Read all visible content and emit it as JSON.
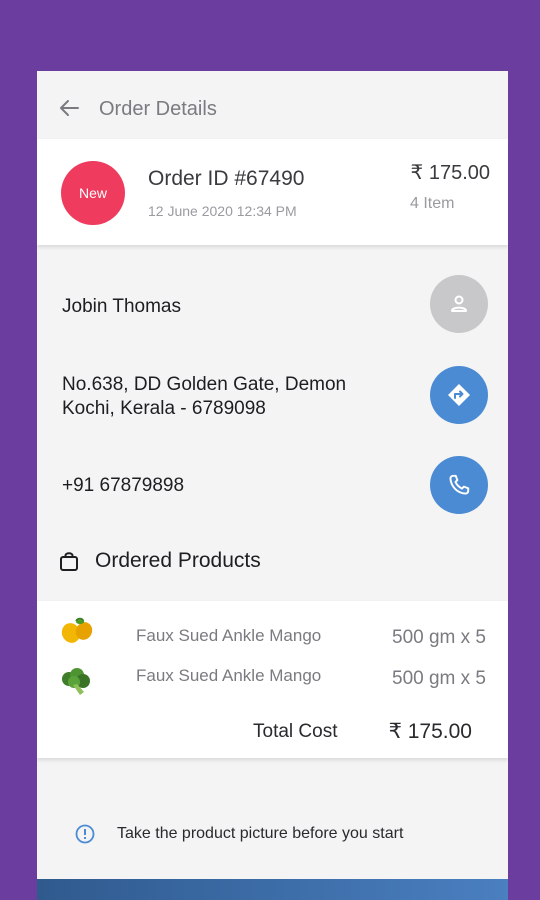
{
  "header": {
    "title": "Order Details"
  },
  "order": {
    "badge": "New",
    "id": "Order ID #67490",
    "date": "12 June 2020 12:34 PM",
    "price": "₹ 175.00",
    "items": "4 Item"
  },
  "customer": {
    "name": "Jobin Thomas",
    "address_line1": "No.638, DD Golden Gate, Demon",
    "address_line2": "Kochi, Kerala -  6789098",
    "phone": "+91 67879898"
  },
  "products_section": {
    "title": "Ordered Products"
  },
  "products": [
    {
      "name": "Faux Sued Ankle Mango",
      "qty": "500 gm x 5",
      "icon": "mango-icon"
    },
    {
      "name": "Faux Sued Ankle Mango",
      "qty": "500 gm x 5",
      "icon": "broccoli-icon"
    }
  ],
  "total": {
    "label": "Total Cost",
    "value": "₹ 175.00"
  },
  "notice": {
    "text": "Take the product picture before you start"
  },
  "colors": {
    "background": "#6a3d9e",
    "badge": "#ee3b5e",
    "action_blue": "#4b8bd4"
  }
}
